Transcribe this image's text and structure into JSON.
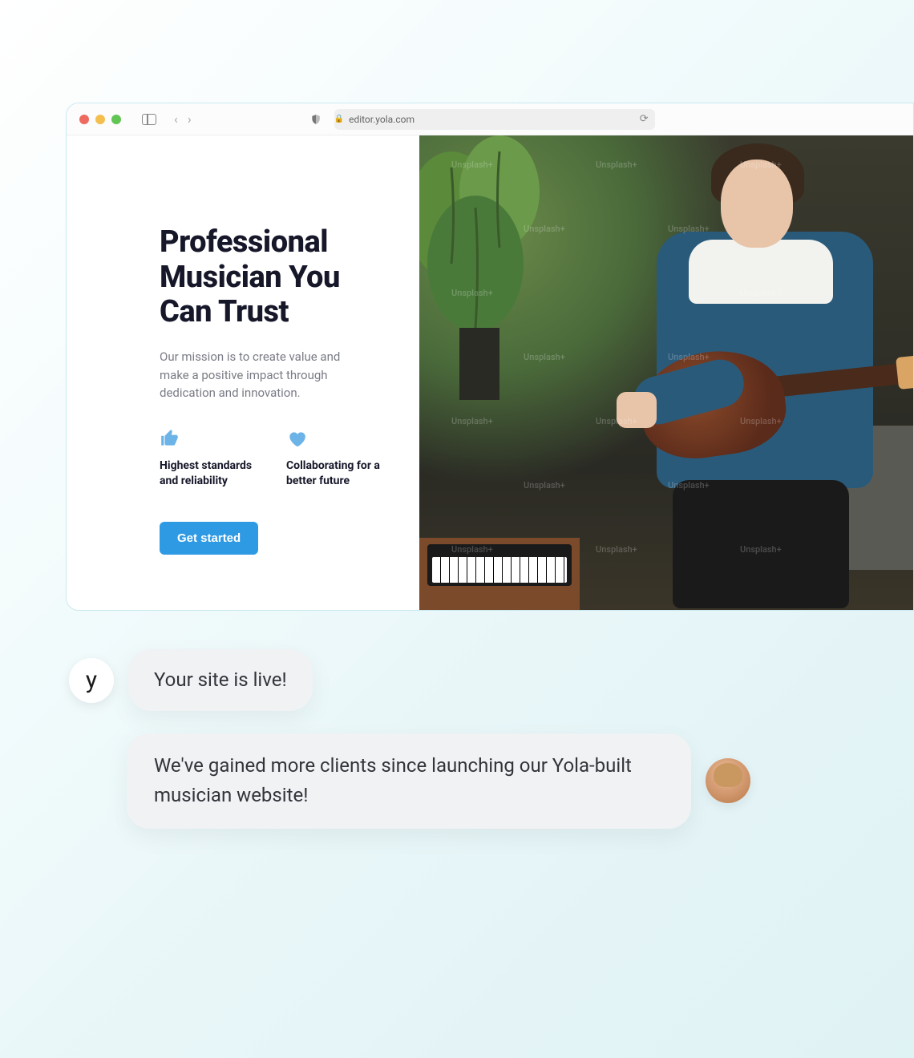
{
  "browser": {
    "url": "editor.yola.com"
  },
  "hero": {
    "headline": "Professional Musician You Can Trust",
    "mission": "Our mission is to create value and make a positive impact through dedication and innovation.",
    "features": [
      {
        "text": "Highest standards and reliability"
      },
      {
        "text": "Collaborating for a better future"
      }
    ],
    "cta": "Get started"
  },
  "image_watermark": "Unsplash+",
  "chat": {
    "avatar_letter": "y",
    "messages": [
      "Your site is live!",
      "We've gained more clients since launching our Yola-built musician website!"
    ]
  }
}
